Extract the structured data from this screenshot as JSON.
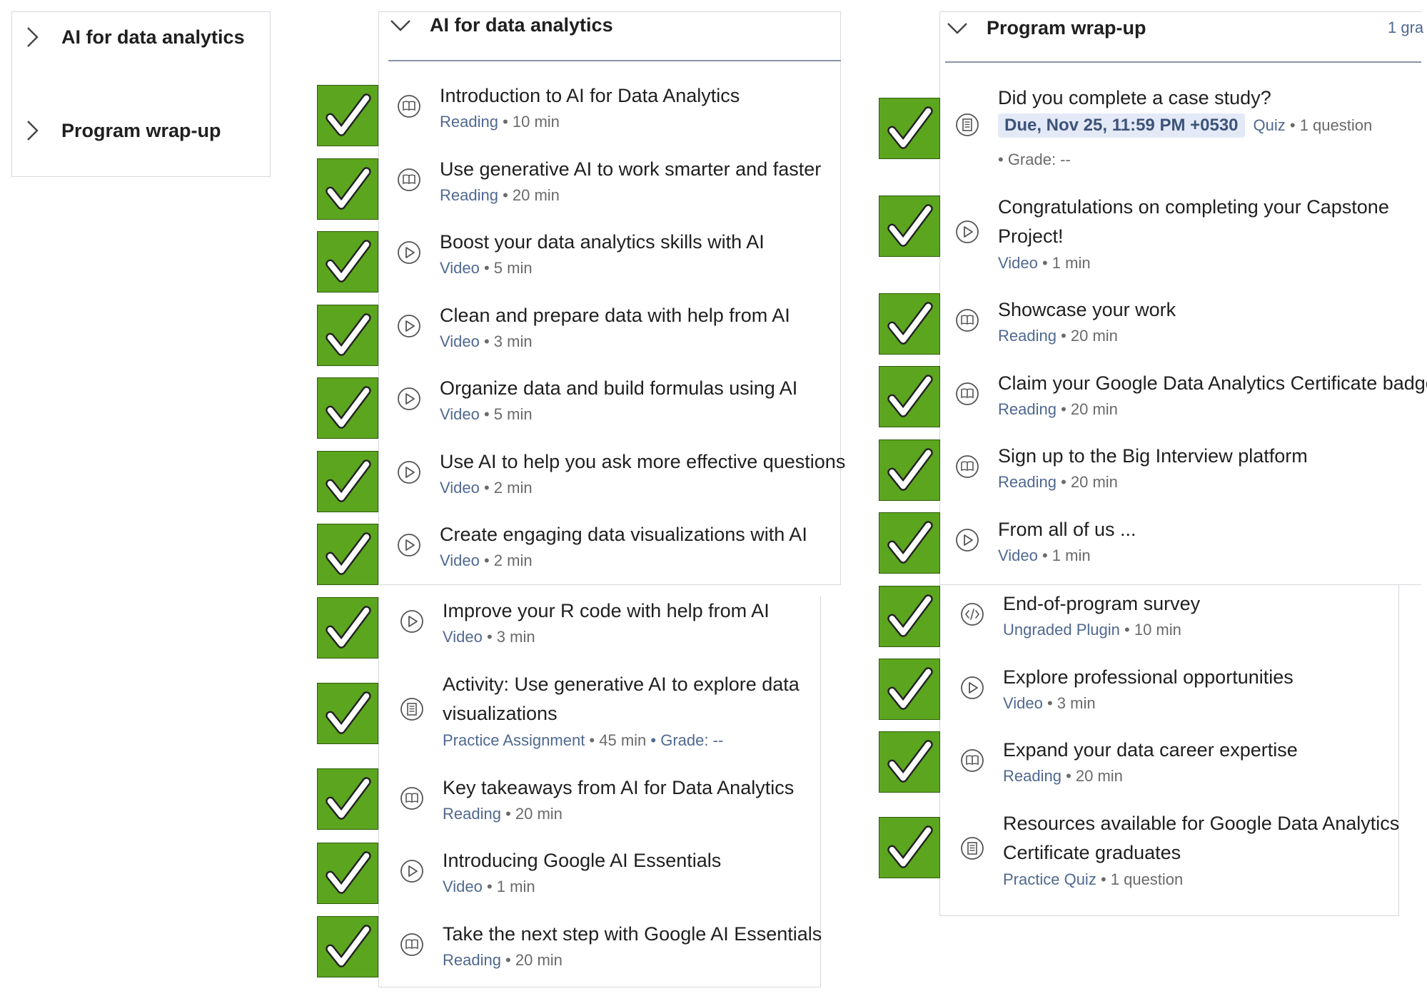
{
  "sidebar": {
    "items": [
      {
        "label": "AI for data analytics"
      },
      {
        "label": "Program wrap-up"
      }
    ]
  },
  "col1": {
    "header": "AI for data analytics",
    "items": [
      {
        "title": "Introduction to AI for Data Analytics",
        "type": "Reading",
        "meta": " • 10 min",
        "icon": "book-icon"
      },
      {
        "title": "Use generative AI to work smarter and faster",
        "type": "Reading",
        "meta": " • 20 min",
        "icon": "book-icon"
      },
      {
        "title": "Boost your data analytics skills with AI",
        "type": "Video",
        "meta": " • 5 min",
        "icon": "play-icon"
      },
      {
        "title": "Clean and prepare data with help from AI",
        "type": "Video",
        "meta": " • 3 min",
        "icon": "play-icon"
      },
      {
        "title": "Organize data and build formulas using AI",
        "type": "Video",
        "meta": " • 5 min",
        "icon": "play-icon"
      },
      {
        "title": "Use AI to help you ask more effective questions",
        "type": "Video",
        "meta": " • 2 min",
        "icon": "play-icon"
      },
      {
        "title": "Create engaging data visualizations with AI",
        "type": "Video",
        "meta": " • 2 min",
        "icon": "play-icon"
      }
    ],
    "items_b": [
      {
        "title": "Improve your R code with help from AI",
        "type": "Video",
        "meta": " • 3 min",
        "icon": "play-icon"
      },
      {
        "title": "Activity: Use generative AI to explore data",
        "title2": "visualizations",
        "type": "Practice Assignment",
        "meta": " • 45 min",
        "grade_label": " • Grade: --",
        "icon": "assignment-icon"
      },
      {
        "title": "Key takeaways from AI for Data Analytics",
        "type": "Reading",
        "meta": " • 20 min",
        "icon": "book-icon"
      },
      {
        "title": "Introducing Google AI Essentials",
        "type": "Video",
        "meta": " • 1 min",
        "icon": "play-icon"
      },
      {
        "title": "Take the next step with Google AI Essentials",
        "type": "Reading",
        "meta": " • 20 min",
        "icon": "book-icon"
      }
    ]
  },
  "col2": {
    "header": "Program wrap-up",
    "header_right": "1 gra",
    "quiz": {
      "title": "Did you complete a case study?",
      "due": "Due, Nov 25, 11:59 PM +0530",
      "type": "Quiz",
      "meta": " • 1 question",
      "grade": "• Grade: --"
    },
    "items": [
      {
        "title": "Congratulations on completing your Capstone",
        "title2": "Project!",
        "type": "Video",
        "meta": " • 1 min",
        "icon": "play-icon"
      },
      {
        "title": "Showcase your work",
        "type": "Reading",
        "meta": " • 20 min",
        "icon": "book-icon"
      },
      {
        "title": "Claim your Google Data Analytics Certificate badge",
        "type": "Reading",
        "meta": " • 20 min",
        "icon": "book-icon"
      },
      {
        "title": "Sign up to the Big Interview platform",
        "type": "Reading",
        "meta": " • 20 min",
        "icon": "book-icon"
      },
      {
        "title": "From all of us ...",
        "type": "Video",
        "meta": " • 1 min",
        "icon": "play-icon"
      }
    ],
    "items_b": [
      {
        "title": "End-of-program survey",
        "type": "Ungraded Plugin",
        "meta": " • 10 min",
        "icon": "code-icon"
      },
      {
        "title": "Explore professional opportunities",
        "type": "Video",
        "meta": " • 3 min",
        "icon": "play-icon"
      },
      {
        "title": "Expand your data career expertise",
        "type": "Reading",
        "meta": " • 20 min",
        "icon": "book-icon"
      },
      {
        "title": "Resources available for Google Data Analytics",
        "title2": "Certificate graduates",
        "type": "Practice Quiz",
        "meta": " • 1 question",
        "icon": "assignment-icon"
      }
    ]
  },
  "colors": {
    "check_green": "#5ca51e",
    "type_blue": "#4f6890",
    "divider": "#8a94a6"
  }
}
